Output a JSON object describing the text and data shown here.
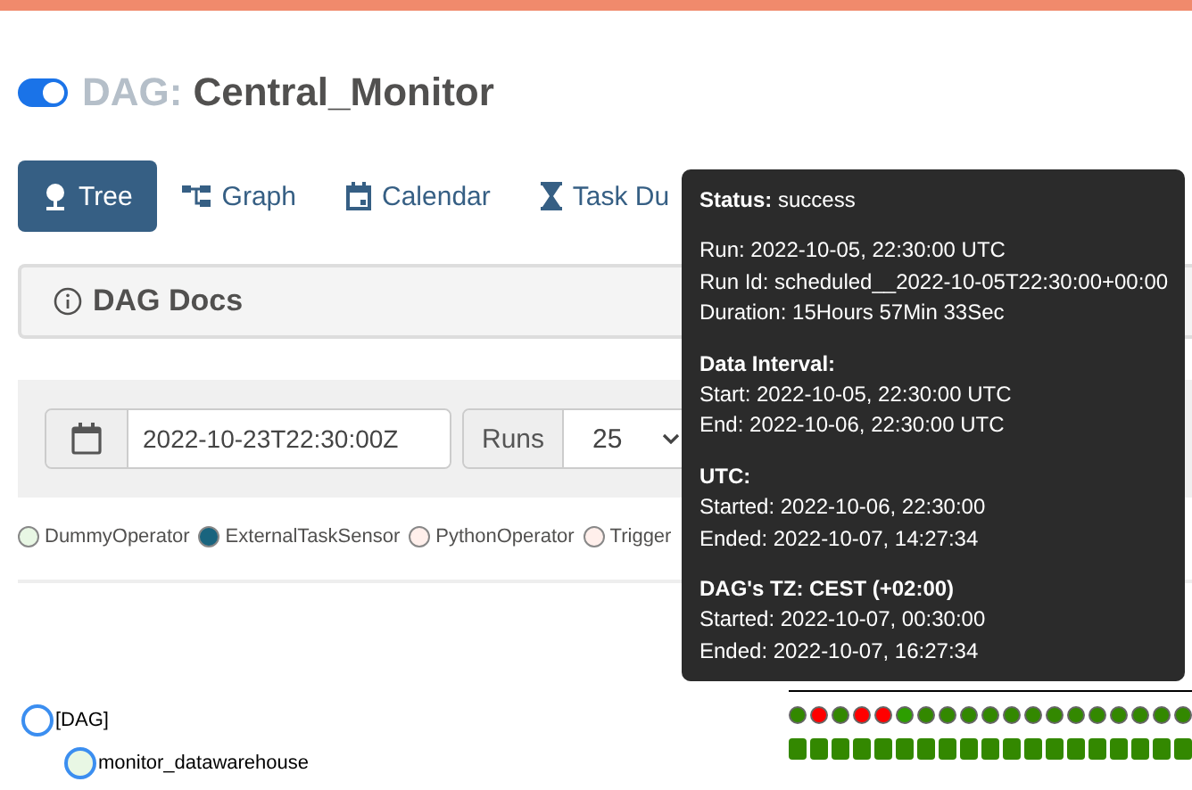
{
  "header": {
    "paused_toggle": {
      "on": true
    },
    "prefix": "DAG:",
    "dag_id": "Central_Monitor"
  },
  "tabs": [
    {
      "label": "Tree",
      "selected": true
    },
    {
      "label": "Graph",
      "selected": false
    },
    {
      "label": "Calendar",
      "selected": false
    },
    {
      "label": "Task Du",
      "selected": false
    }
  ],
  "docs_panel": {
    "title": "DAG Docs"
  },
  "controls": {
    "base_date": "2022-10-23T22:30:00Z",
    "runs_label": "Runs",
    "runs_value": "25"
  },
  "legend": [
    {
      "label": "DummyOperator",
      "color": "#e8f7e4"
    },
    {
      "label": "ExternalTaskSensor",
      "color": "#19647e"
    },
    {
      "label": "PythonOperator",
      "color": "#ffefeb"
    },
    {
      "label": "Trigger",
      "color": "#ffefeb"
    }
  ],
  "tree": {
    "nodes": [
      {
        "label": "[DAG]",
        "children": [
          {
            "label": "monitor_datawarehouse"
          }
        ]
      }
    ],
    "runs": [
      {
        "color": "#338800"
      },
      {
        "color": "#ff0000"
      },
      {
        "color": "#338800"
      },
      {
        "color": "#ff0000"
      },
      {
        "color": "#ff0000"
      },
      {
        "color": "#2d9e00"
      },
      {
        "color": "#338800"
      },
      {
        "color": "#338800"
      },
      {
        "color": "#338800"
      },
      {
        "color": "#338800"
      },
      {
        "color": "#338800"
      },
      {
        "color": "#338800"
      },
      {
        "color": "#338800"
      },
      {
        "color": "#338800"
      },
      {
        "color": "#338800"
      },
      {
        "color": "#338800"
      },
      {
        "color": "#338800"
      },
      {
        "color": "#338800"
      },
      {
        "color": "#338800"
      }
    ]
  },
  "tooltip": {
    "sections": [
      {
        "lines": [
          "**Status:** success"
        ]
      },
      {
        "lines": [
          "Run: 2022-10-05, 22:30:00 UTC",
          "Run Id: scheduled__2022-10-05T22:30:00+00:00",
          "Duration: 15Hours 57Min 33Sec"
        ]
      },
      {
        "heading": "Data Interval:",
        "lines": [
          "Start: 2022-10-05, 22:30:00 UTC",
          "End: 2022-10-06, 22:30:00 UTC"
        ]
      },
      {
        "heading": "UTC:",
        "lines": [
          "Started: 2022-10-06, 22:30:00",
          "Ended: 2022-10-07, 14:27:34"
        ]
      },
      {
        "heading": "DAG's TZ: CEST (+02:00)",
        "lines": [
          "Started: 2022-10-07, 00:30:00",
          "Ended: 2022-10-07, 16:27:34"
        ]
      }
    ]
  }
}
